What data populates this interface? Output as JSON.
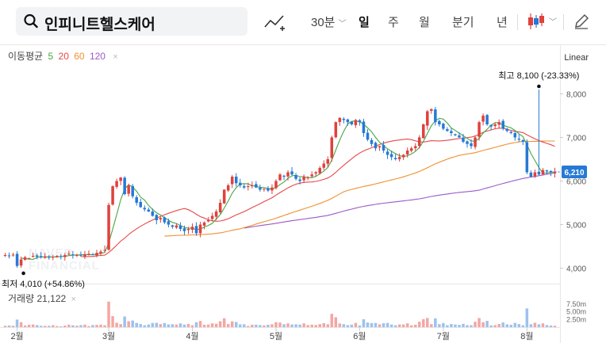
{
  "toolbar": {
    "stock_name": "인피니트헬스케어",
    "interval_30m": "30분",
    "period_day": "일",
    "period_week": "주",
    "period_month": "월",
    "period_quarter": "분기",
    "period_year": "년"
  },
  "legend": {
    "ma_label": "이동평균",
    "ma5": "5",
    "ma20": "20",
    "ma60": "60",
    "ma120": "120",
    "close": "×",
    "volume_label": "거래량",
    "volume_value": "21,122",
    "volume_close": "×",
    "scale_type": "Linear",
    "watermark_line1": "NAVER",
    "watermark_line2": "FINANCIAL"
  },
  "colors": {
    "up": "#e0413c",
    "down": "#2679d6",
    "ma5": "#48a648",
    "ma20": "#e84747",
    "ma60": "#f0902d",
    "ma120": "#9b59c9",
    "price_tag": "#2679d6"
  },
  "chart_data": {
    "type": "candlestick",
    "y_ticks": [
      "8,000",
      "7,000",
      "6,000",
      "5,000",
      "4,000"
    ],
    "y_tick_values": [
      8000,
      7000,
      6000,
      5000,
      4000
    ],
    "ylim": [
      3700,
      8700
    ],
    "x_labels": [
      "2월",
      "3월",
      "4월",
      "5월",
      "6월",
      "7월",
      "8월"
    ],
    "x_label_index": [
      3,
      26,
      47,
      68,
      89,
      110,
      131
    ],
    "last_price": 6210,
    "last_price_label": "6,210",
    "high_annotation": {
      "label": "최고",
      "value": "8,100",
      "pct": "(-23.33%)",
      "index": 134
    },
    "low_annotation": {
      "label": "최저",
      "value": "4,010",
      "pct": "(+54.86%)",
      "index": 3
    },
    "volume_ticks": [
      "7.50m",
      "5.00m",
      "2.50m"
    ],
    "volume_tick_values": [
      7.5,
      5.0,
      2.5
    ],
    "volume_max": 9,
    "closes": [
      4300,
      4290,
      4310,
      4050,
      4200,
      4250,
      4230,
      4280,
      4260,
      4250,
      4270,
      4240,
      4260,
      4280,
      4270,
      4300,
      4330,
      4310,
      4300,
      4290,
      4320,
      4330,
      4310,
      4350,
      4380,
      4420,
      5450,
      5880,
      6000,
      6080,
      5700,
      5900,
      5650,
      5500,
      5400,
      5350,
      5300,
      5200,
      5100,
      5150,
      5050,
      5000,
      4950,
      4980,
      4900,
      4850,
      4900,
      4950,
      4800,
      5000,
      5050,
      5100,
      5200,
      5300,
      5500,
      5800,
      5900,
      6100,
      5950,
      5900,
      5850,
      5880,
      5900,
      5850,
      5800,
      5820,
      5780,
      5850,
      6000,
      6150,
      6100,
      6200,
      6150,
      6050,
      6000,
      6100,
      6080,
      6150,
      6200,
      6300,
      6400,
      6500,
      7000,
      7350,
      7450,
      7400,
      7350,
      7300,
      7400,
      7350,
      7100,
      6950,
      6850,
      6750,
      6800,
      6700,
      6600,
      6550,
      6500,
      6550,
      6600,
      6700,
      6750,
      6800,
      7000,
      7300,
      7600,
      7650,
      7350,
      7300,
      7200,
      7150,
      7100,
      7050,
      7000,
      6900,
      6850,
      6800,
      7000,
      7350,
      7500,
      7300,
      7250,
      7300,
      7350,
      7200,
      7150,
      7100,
      7000,
      6950,
      6900,
      6200,
      6100,
      6200,
      6150,
      6250,
      6220,
      6200,
      6210
    ],
    "ma5_start": 4,
    "ma20_start": 19,
    "ma60_start": 40,
    "ma120_start": 60
  }
}
